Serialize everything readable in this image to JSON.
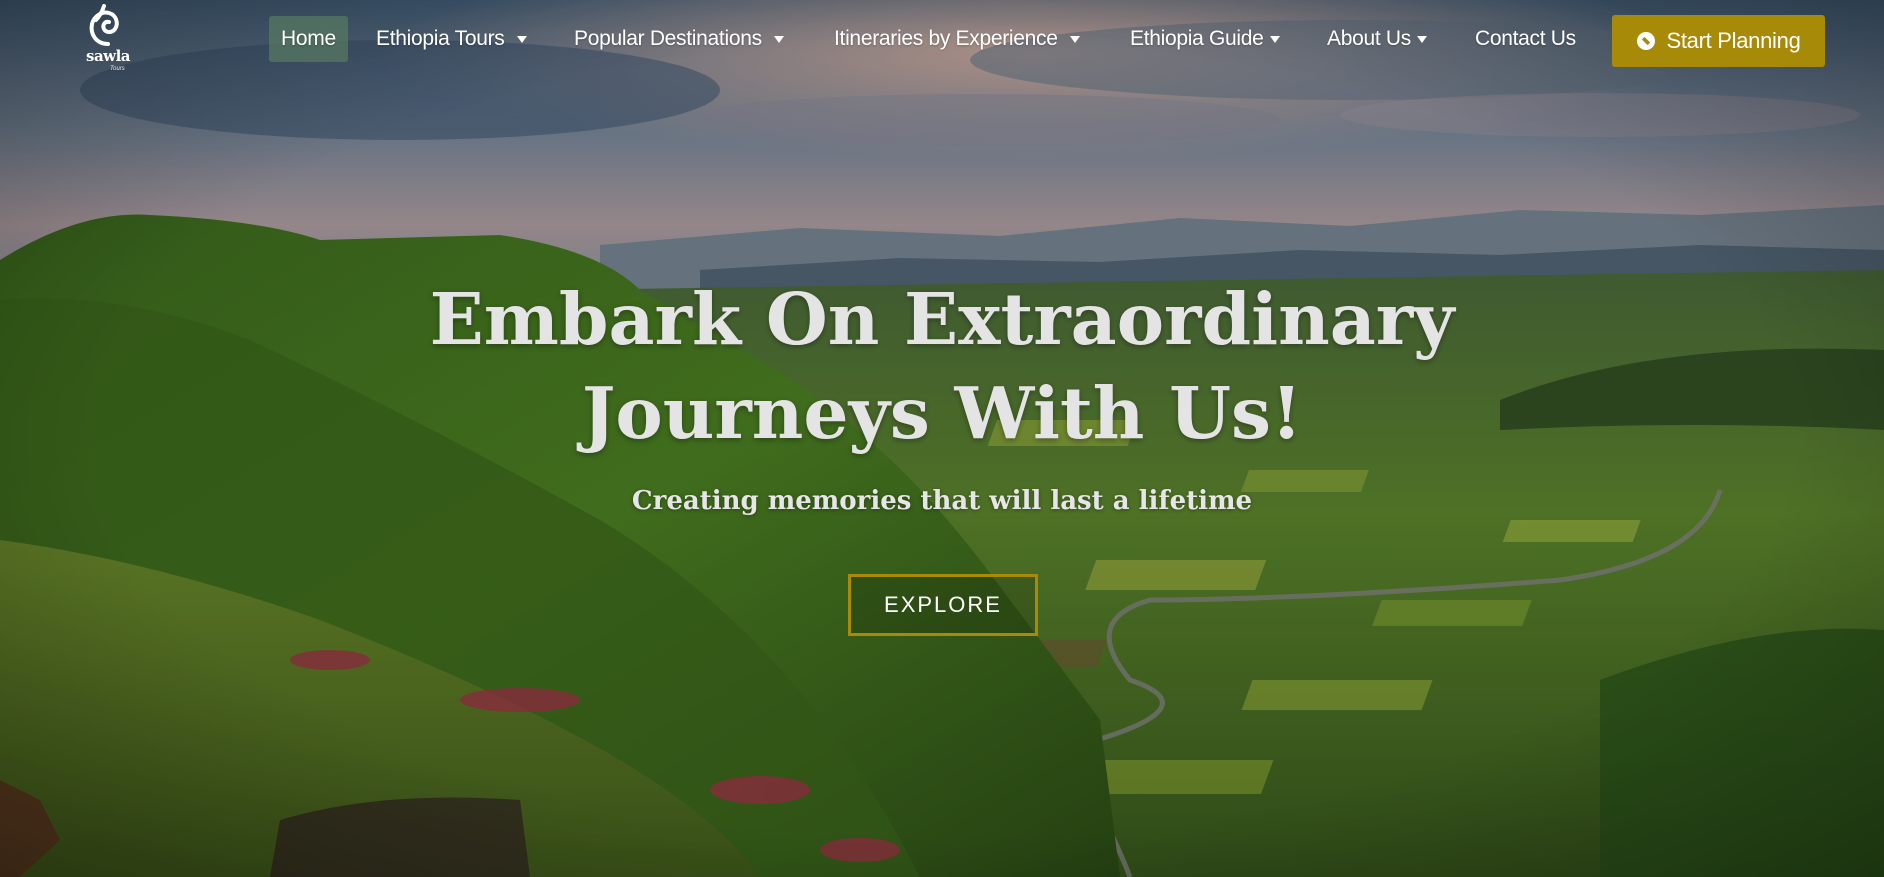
{
  "brand": {
    "name": "sawla",
    "tagline": "Tours",
    "logo_icon": "spiral-logo-icon"
  },
  "nav": {
    "items": [
      {
        "label": "Home",
        "active": true,
        "dropdown": false
      },
      {
        "label": "Ethiopia Tours",
        "active": false,
        "dropdown": true
      },
      {
        "label": "Popular Destinations",
        "active": false,
        "dropdown": true
      },
      {
        "label": "Itineraries by Experience",
        "active": false,
        "dropdown": true
      },
      {
        "label": "Ethiopia Guide",
        "active": false,
        "dropdown": true
      },
      {
        "label": "About Us",
        "active": false,
        "dropdown": true
      },
      {
        "label": "Contact Us",
        "active": false,
        "dropdown": false
      }
    ],
    "cta_label": "Start Planning",
    "cta_icon": "compass-icon"
  },
  "hero": {
    "headline_line1": "Embark On Extraordinary",
    "headline_line2": "Journeys With Us!",
    "subheadline": "Creating memories that will last a lifetime",
    "button_label": "EXPLORE"
  },
  "colors": {
    "accent": "#a88a09",
    "active_nav_bg": "#567860",
    "text": "#ffffff"
  }
}
